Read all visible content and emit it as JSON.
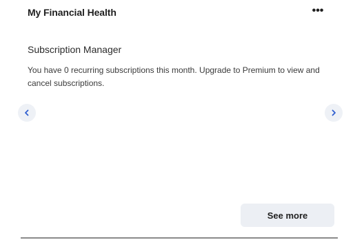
{
  "card": {
    "title": "My Financial Health",
    "menu_glyph": "•••",
    "section_title": "Subscription Manager",
    "description": "You have 0 recurring subscriptions this month. Upgrade to Premium to view and cancel subscriptions.",
    "see_more_label": "See more"
  },
  "icons": {
    "prev": "chevron-left-icon",
    "next": "chevron-right-icon",
    "menu": "more-horizontal-icon"
  },
  "colors": {
    "accent": "#2f5fd0",
    "nav_bg": "#eef1f6",
    "button_bg": "#eceff4"
  }
}
